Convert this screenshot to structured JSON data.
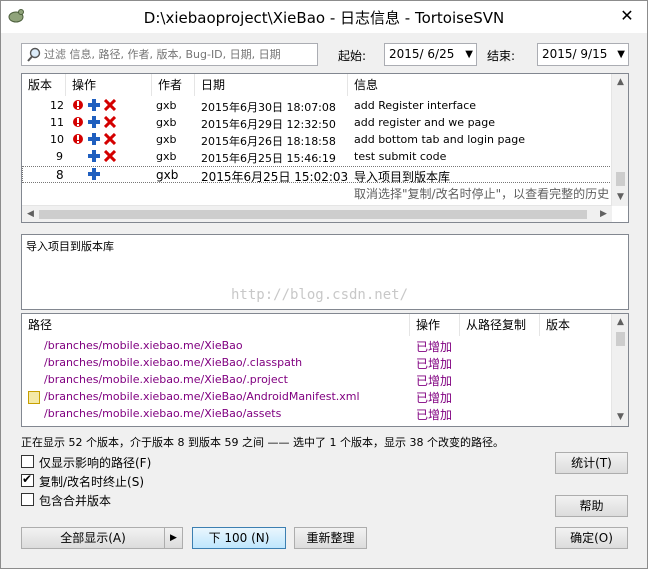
{
  "window": {
    "title": "D:\\xiebaoproject\\XieBao - 日志信息 - TortoiseSVN",
    "close_glyph": "✕"
  },
  "filter": {
    "placeholder": "过滤 信息, 路径, 作者, 版本, Bug-ID, 日期, 日期",
    "from_label": "起始:",
    "from_value": "2015/ 6/25",
    "to_label": "结束:",
    "to_value": "2015/ 9/15"
  },
  "log_columns": [
    "版本",
    "操作",
    "作者",
    "日期",
    "信息"
  ],
  "log_rows": [
    {
      "rev": "12",
      "author": "gxb",
      "date": "2015年6月30日 18:07:08",
      "message": "add Register interface",
      "icons": [
        "modify",
        "add",
        "delete"
      ]
    },
    {
      "rev": "11",
      "author": "gxb",
      "date": "2015年6月29日 12:32:50",
      "message": "add register and we page",
      "icons": [
        "modify",
        "add",
        "delete"
      ]
    },
    {
      "rev": "10",
      "author": "gxb",
      "date": "2015年6月26日 18:18:58",
      "message": "add bottom tab and login page",
      "icons": [
        "modify",
        "add",
        "delete"
      ]
    },
    {
      "rev": "9",
      "author": "gxb",
      "date": "2015年6月25日 15:46:19",
      "message": "test submit code",
      "icons": [
        "add",
        "delete"
      ]
    },
    {
      "rev": "8",
      "author": "gxb",
      "date": "2015年6月25日 15:02:03",
      "message": "导入项目到版本库",
      "icons": [
        "add"
      ]
    }
  ],
  "log_hint": "取消选择\"复制/改名时停止\"，以查看完整的历史",
  "message_text": "导入项目到版本库",
  "watermark": "http://blog.csdn.net/",
  "path_columns": [
    "路径",
    "操作",
    "从路径复制",
    "版本"
  ],
  "path_rows": [
    {
      "path": "/branches/mobile.xiebao.me/XieBao",
      "action": "已增加",
      "type": "folder"
    },
    {
      "path": "/branches/mobile.xiebao.me/XieBao/.classpath",
      "action": "已增加",
      "type": "file"
    },
    {
      "path": "/branches/mobile.xiebao.me/XieBao/.project",
      "action": "已增加",
      "type": "file"
    },
    {
      "path": "/branches/mobile.xiebao.me/XieBao/AndroidManifest.xml",
      "action": "已增加",
      "type": "xml"
    },
    {
      "path": "/branches/mobile.xiebao.me/XieBao/assets",
      "action": "已增加",
      "type": "folder"
    }
  ],
  "status_text": "正在显示 52 个版本，介于版本 8 到版本 59 之间 —— 选中了 1 个版本，显示 38 个改变的路径。",
  "options": [
    {
      "label": "仅显示影响的路径(F)",
      "checked": false
    },
    {
      "label": "复制/改名时终止(S)",
      "checked": true
    },
    {
      "label": "包含合并版本",
      "checked": false
    }
  ],
  "buttons": {
    "stats": "统计(T)",
    "help": "帮助",
    "show_all": "全部显示(A)",
    "next_100": "下 100 (N)",
    "refresh": "重新整理",
    "ok": "确定(O)"
  },
  "colors": {
    "added_text": "#800080",
    "modify_icon": "#d40000",
    "add_icon": "#1f5fbf",
    "delete_icon": "#d40000"
  }
}
